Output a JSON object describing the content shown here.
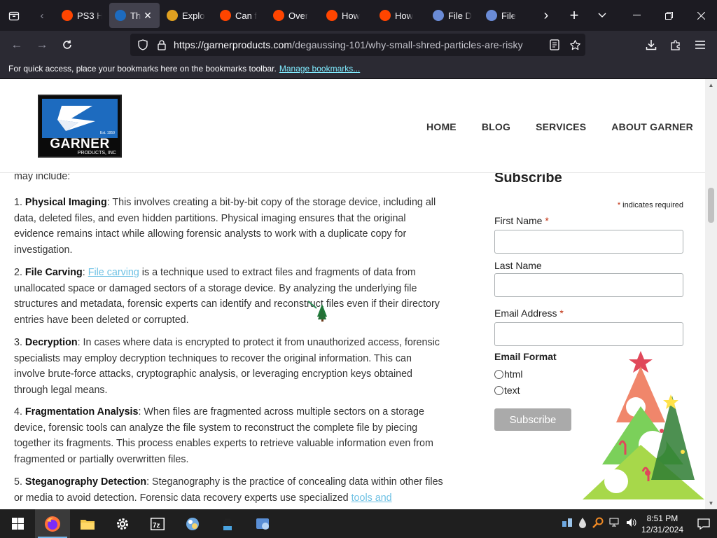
{
  "browser": {
    "tabs": [
      {
        "label": "PS3 H",
        "favicon_color": "#ff4500",
        "active": false
      },
      {
        "label": "Th",
        "favicon_color": "#1d6bbf",
        "active": true
      },
      {
        "label": "Explo",
        "favicon_color": "#e0a020",
        "active": false
      },
      {
        "label": "Can f",
        "favicon_color": "#ff4500",
        "active": false
      },
      {
        "label": "Over",
        "favicon_color": "#ff4500",
        "active": false
      },
      {
        "label": "How",
        "favicon_color": "#ff4500",
        "active": false
      },
      {
        "label": "How",
        "favicon_color": "#ff4500",
        "active": false
      },
      {
        "label": "File D",
        "favicon_color": "#6a8bd6",
        "active": false
      },
      {
        "label": "File",
        "favicon_color": "#6a8bd6",
        "active": false
      }
    ],
    "url_host": "https://garnerproducts.com",
    "url_path": "/degaussing-101/why-small-shred-particles-are-risky",
    "bookmarks_message": "For quick access, place your bookmarks here on the bookmarks toolbar.",
    "bookmarks_link": "Manage bookmarks..."
  },
  "site": {
    "logo_text": "GARNER",
    "logo_sub": "PRODUCTS, INC",
    "logo_est": "Est. 1959",
    "nav": [
      "HOME",
      "BLOG",
      "SERVICES",
      "ABOUT GARNER"
    ]
  },
  "article": {
    "intro": "may include:",
    "items": [
      {
        "num": "1.",
        "title": "Physical Imaging",
        "link": "",
        "text": ": This involves creating a bit-by-bit copy of the storage device, including all data, deleted files, and even hidden partitions. Physical imaging ensures that the original evidence remains intact while allowing forensic analysts to work with a duplicate copy for investigation.",
        "after": ""
      },
      {
        "num": "2.",
        "title": "File Carving",
        "link": "File carving",
        "text": ": ",
        "after": " is a technique used to extract files and fragments of data from unallocated space or damaged sectors of a storage device. By analyzing the underlying file structures and metadata, forensic experts can identify and reconstruct files even if their directory entries have been deleted or corrupted."
      },
      {
        "num": "3.",
        "title": "Decryption",
        "link": "",
        "text": ": In cases where data is encrypted to protect it from unauthorized access, forensic specialists may employ decryption techniques to recover the original information. This can involve brute-force attacks, cryptographic analysis, or leveraging encryption keys obtained through legal means.",
        "after": ""
      },
      {
        "num": "4.",
        "title": "Fragmentation Analysis",
        "link": "",
        "text": ": When files are fragmented across multiple sectors on a storage device, forensic tools can analyze the file system to reconstruct the complete file by piecing together its fragments. This process enables experts to retrieve valuable information even from fragmented or partially overwritten files.",
        "after": ""
      },
      {
        "num": "5.",
        "title": "Steganography Detection",
        "link": "tools and",
        "text": ": Steganography is the practice of concealing data within other files or media to avoid detection. Forensic data recovery experts use specialized ",
        "after": ""
      }
    ]
  },
  "subscribe": {
    "heading": "Subscribe",
    "required_note": "indicates required",
    "asterisk": "*",
    "first_name_label": "First Name",
    "last_name_label": "Last Name",
    "email_label": "Email Address",
    "format_label": "Email Format",
    "format_options": [
      "html",
      "text"
    ],
    "button_label": "Subscribe"
  },
  "taskbar": {
    "time": "8:51 PM",
    "date": "12/31/2024",
    "apps": [
      "start-icon",
      "firefox-icon",
      "file-explorer-icon",
      "settings-icon",
      "7zip-icon",
      "app-icon",
      "app-icon",
      "app-icon"
    ]
  }
}
